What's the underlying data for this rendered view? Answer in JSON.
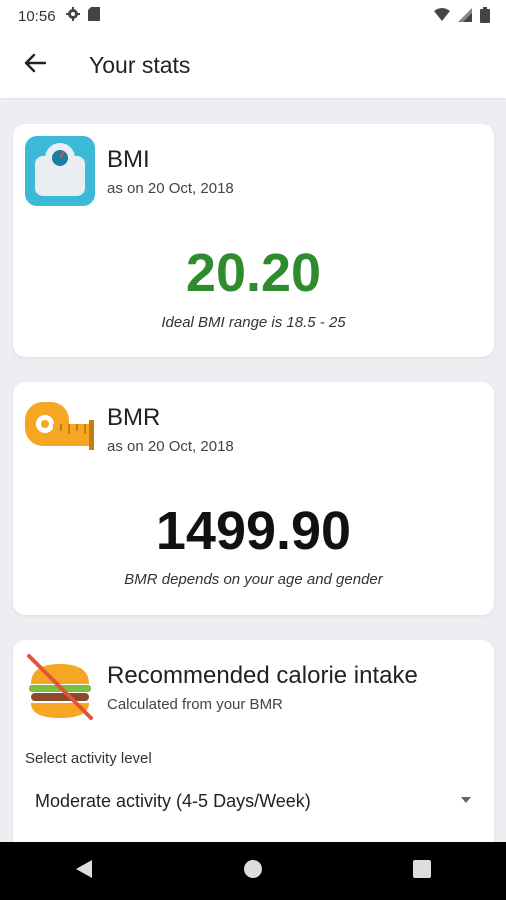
{
  "status_bar": {
    "time": "10:56",
    "icons": [
      "gear-icon",
      "sd-card-icon",
      "wifi-icon",
      "signal-icon",
      "battery-icon"
    ]
  },
  "app_bar": {
    "back_icon": "back-arrow-icon",
    "title": "Your stats"
  },
  "bmi_card": {
    "icon": "weighing-scale-icon",
    "title": "BMI",
    "subtitle": "as on 20 Oct, 2018",
    "value": "20.20",
    "value_color": "#2e8b2e",
    "note": "Ideal BMI range is 18.5 - 25"
  },
  "bmr_card": {
    "icon": "measuring-tape-icon",
    "title": "BMR",
    "subtitle": "as on 20 Oct, 2018",
    "value": "1499.90",
    "value_color": "#111111",
    "note": "BMR depends on your age and gender"
  },
  "calorie_card": {
    "icon": "no-burger-icon",
    "title": "Recommended calorie intake",
    "subtitle": "Calculated from your BMR",
    "activity_label": "Select activity level",
    "activity_selected": "Moderate activity (4-5 Days/Week)"
  },
  "colors": {
    "background": "#eeeef2",
    "bmi_icon_bg": "#3bb9d6",
    "tape_color": "#f5a623",
    "no_sign_red": "#e5533d"
  },
  "nav_bar": {
    "icons": [
      "back-triangle-icon",
      "home-circle-icon",
      "recents-square-icon"
    ]
  }
}
